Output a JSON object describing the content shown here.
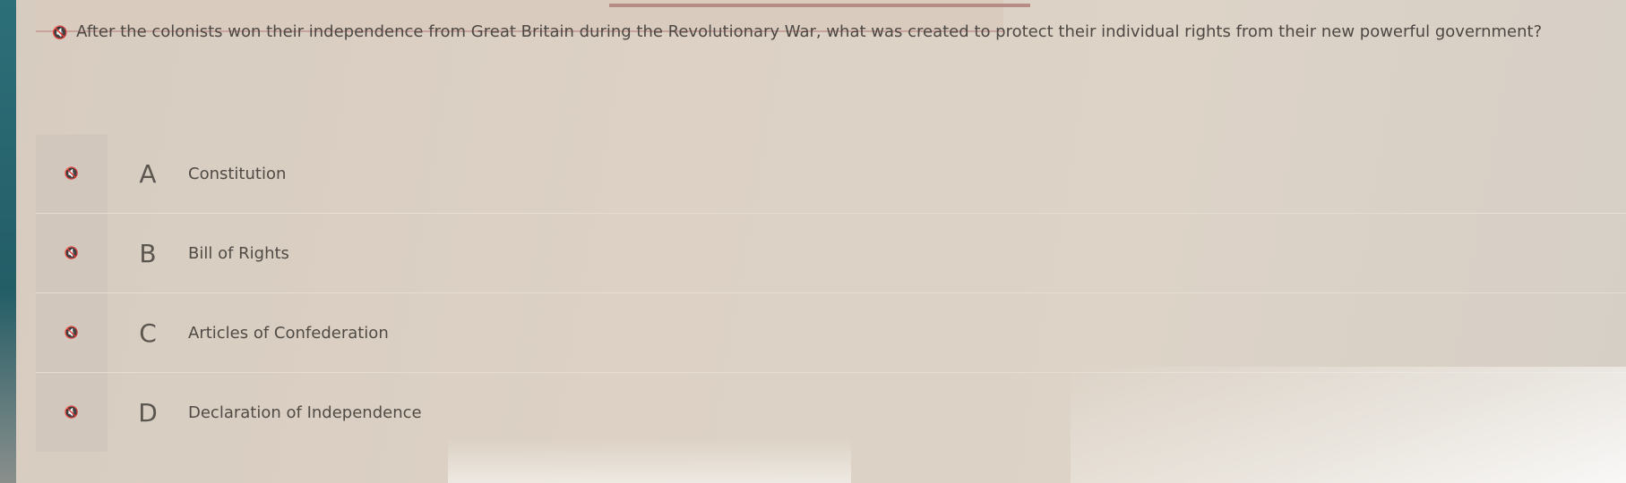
{
  "question": {
    "text": "After the colonists won their independence from Great Britain during the Revolutionary War, what was created to protect their individual rights from their new powerful government?",
    "speaker_icon": "speaker-icon"
  },
  "answers": [
    {
      "letter": "A",
      "label": "Constitution"
    },
    {
      "letter": "B",
      "label": "Bill of Rights"
    },
    {
      "letter": "C",
      "label": "Articles of Confederation"
    },
    {
      "letter": "D",
      "label": "Declaration of Independence"
    }
  ],
  "colors": {
    "background": "#dcd1c4",
    "accent_teal": "#2d6f79"
  }
}
